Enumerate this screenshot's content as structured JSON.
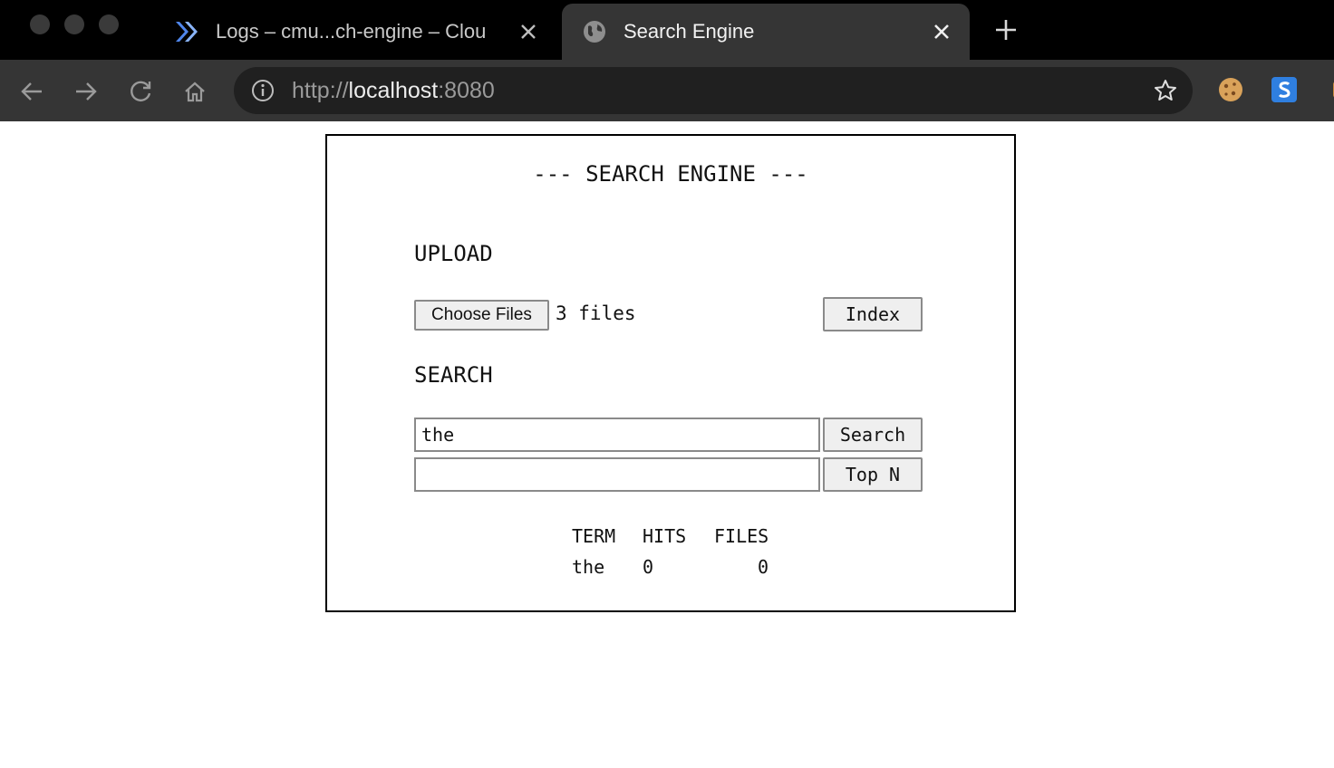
{
  "browser": {
    "tabs": [
      {
        "title": "Logs – cmu...ch-engine – Clou",
        "active": false,
        "icon": "cloud-run-icon"
      },
      {
        "title": "Search Engine",
        "active": true,
        "icon": "globe-icon"
      }
    ],
    "url_scheme": "http://",
    "url_host": "localhost",
    "url_port": ":8080",
    "colors": {
      "tabstrip": "#000000",
      "toolbar": "#353535",
      "omnibox": "#202020"
    }
  },
  "page": {
    "title": "--- SEARCH ENGINE ---",
    "upload": {
      "heading": "UPLOAD",
      "choose_label": "Choose Files",
      "file_status": "3 files",
      "index_label": "Index"
    },
    "search": {
      "heading": "SEARCH",
      "query_value": "the",
      "topn_value": "",
      "search_label": "Search",
      "topn_label": "Top N"
    },
    "results": {
      "headers": [
        "TERM",
        "HITS",
        "FILES"
      ],
      "rows": [
        {
          "term": "the",
          "hits": "0",
          "files": "0"
        }
      ]
    }
  }
}
